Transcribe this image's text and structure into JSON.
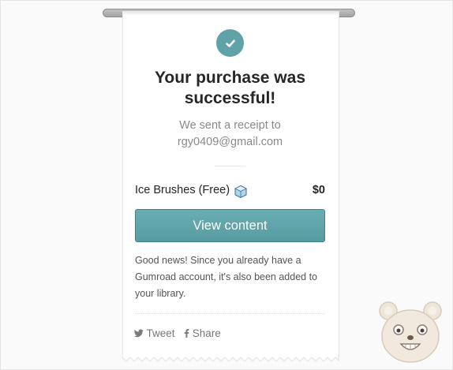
{
  "receipt": {
    "title": "Your purchase was successful!",
    "receipt_line1": "We sent a receipt to",
    "receipt_email": "rgy0409@gmail.com",
    "product_name": "Ice Brushes (Free)",
    "product_price": "$0",
    "view_button_label": "View content",
    "note": "Good news! Since you already have a Gumroad account, it's also been added to your library.",
    "tweet_label": "Tweet",
    "share_label": "Share"
  },
  "icons": {
    "success": "check-icon",
    "product": "ice-cube-icon",
    "tweet": "twitter-icon",
    "share": "facebook-icon",
    "mascot": "bear-face"
  },
  "colors": {
    "accent": "#5fa3a8",
    "button_top": "#6aaeb3",
    "button_bottom": "#559ca1",
    "text_dark": "#262626",
    "text_muted": "#8a8a8a"
  }
}
